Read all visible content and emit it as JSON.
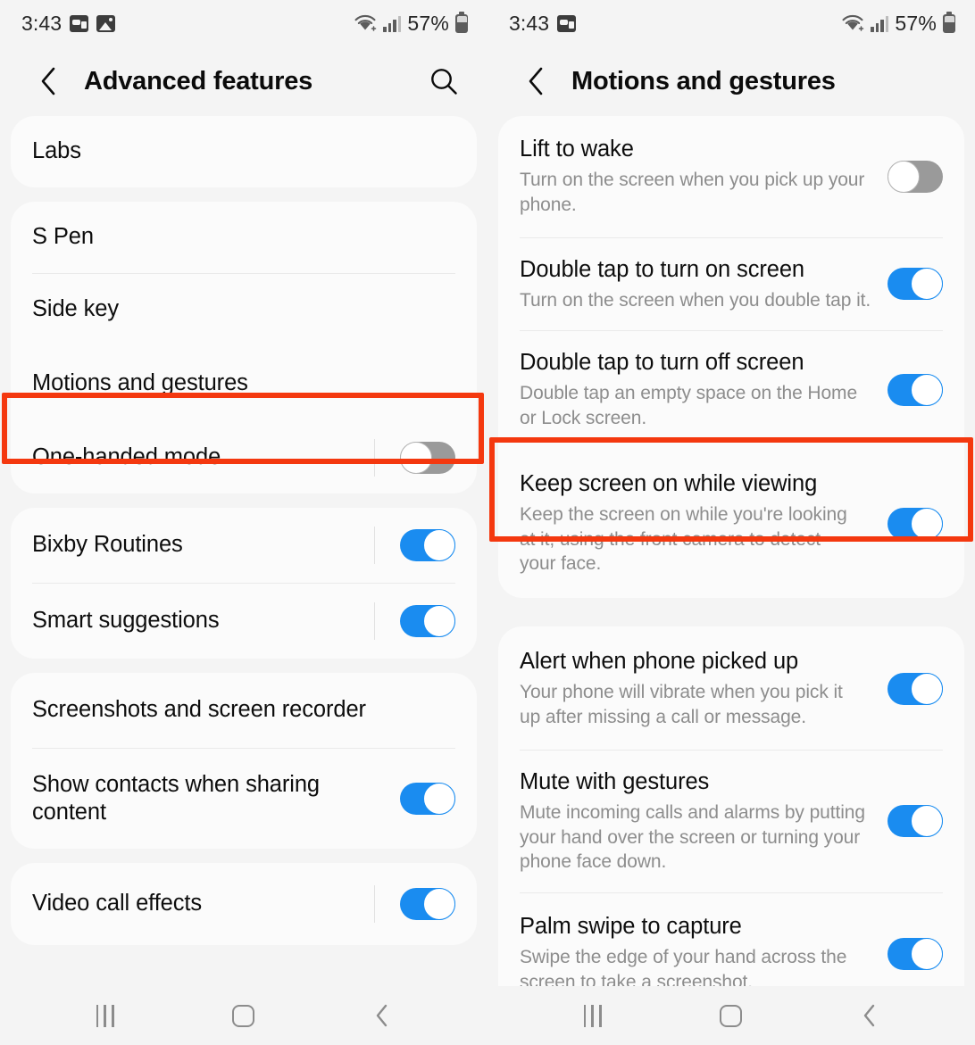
{
  "statusbar": {
    "time": "3:43",
    "battery": "57%",
    "icons_left": [
      "vpn-icon",
      "image-icon"
    ],
    "icons_left_right_panel": [
      "vpn-icon"
    ],
    "icons_right": [
      "wifi-icon",
      "signal-icon",
      "battery-icon"
    ]
  },
  "left_screen": {
    "appbar": {
      "title": "Advanced features",
      "back_icon": "chevron-left-icon",
      "search_icon": "search-icon"
    },
    "groups": [
      {
        "rows": [
          {
            "title": "Labs",
            "toggle": null,
            "divider_after": false
          }
        ]
      },
      {
        "rows": [
          {
            "title": "S Pen",
            "toggle": null,
            "divider_after": true
          },
          {
            "title": "Side key",
            "toggle": null,
            "divider_after": false
          },
          {
            "title": "Motions and gestures",
            "toggle": null,
            "divider_after": false,
            "highlighted": true
          },
          {
            "title": "One-handed mode",
            "toggle": "off",
            "divider_after": false,
            "separator": true
          }
        ]
      },
      {
        "rows": [
          {
            "title": "Bixby Routines",
            "toggle": "on",
            "divider_after": true,
            "separator": true
          },
          {
            "title": "Smart suggestions",
            "toggle": "on",
            "divider_after": false,
            "separator": true
          }
        ]
      },
      {
        "rows": [
          {
            "title": "Screenshots and screen recorder",
            "toggle": null,
            "divider_after": true
          },
          {
            "title": "Show contacts when sharing content",
            "toggle": "on",
            "divider_after": false,
            "separator": false
          }
        ]
      },
      {
        "rows": [
          {
            "title": "Video call effects",
            "toggle": "on",
            "divider_after": false,
            "separator": true
          }
        ]
      }
    ]
  },
  "right_screen": {
    "appbar": {
      "title": "Motions and gestures",
      "back_icon": "chevron-left-icon"
    },
    "groups": [
      {
        "rows": [
          {
            "title": "Lift to wake",
            "desc": "Turn on the screen when you pick up your phone.",
            "toggle": "off",
            "divider_after": true
          },
          {
            "title": "Double tap to turn on screen",
            "desc": "Turn on the screen when you double tap it.",
            "toggle": "on",
            "divider_after": true
          },
          {
            "title": "Double tap to turn off screen",
            "desc": "Double tap an empty space on the Home or Lock screen.",
            "toggle": "on",
            "divider_after": false
          },
          {
            "title": "Keep screen on while viewing",
            "desc": "Keep the screen on while you're looking at it, using the front camera to detect your face.",
            "toggle": "on",
            "divider_after": false,
            "highlighted": true
          }
        ]
      },
      {
        "rows": [
          {
            "title": "Alert when phone picked up",
            "desc": "Your phone will vibrate when you pick it up after missing a call or message.",
            "toggle": "on",
            "divider_after": true
          },
          {
            "title": "Mute with gestures",
            "desc": "Mute incoming calls and alarms by putting your hand over the screen or turning your phone face down.",
            "toggle": "on",
            "divider_after": true
          },
          {
            "title": "Palm swipe to capture",
            "desc": "Swipe the edge of your hand across the screen to take a screenshot.",
            "toggle": "on",
            "divider_after": false
          }
        ]
      }
    ]
  },
  "navbar": {
    "recents_icon": "recents-icon",
    "home_icon": "home-icon",
    "back_icon": "back-chevron-icon"
  },
  "colors": {
    "accent": "#1a8cf0",
    "highlight": "#f4380f",
    "background": "#f4f4f4",
    "card": "#fbfbfb",
    "title_text": "#0d0d0d",
    "desc_text": "#8d8d8d"
  }
}
